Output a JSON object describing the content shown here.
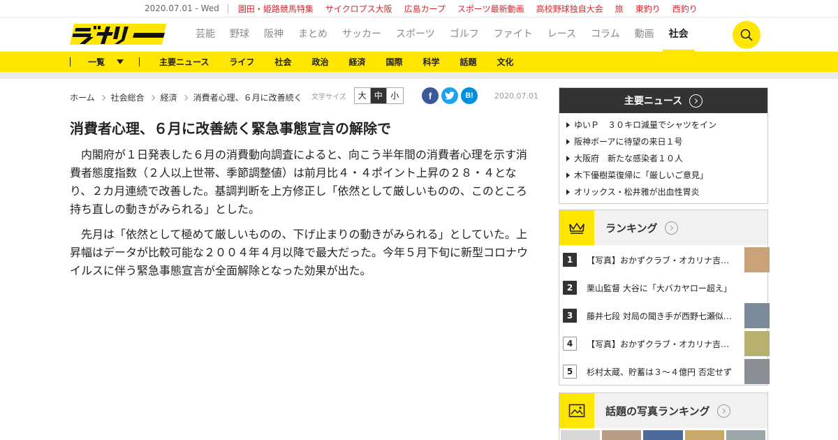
{
  "topbar": {
    "date": "2020.07.01 - Wed",
    "links": [
      "園田・姫路競馬特集",
      "サイクロプス大阪",
      "広島カープ",
      "スポーツ最新動画",
      "高校野球独自大会",
      "旅",
      "東釣り",
      "西釣り"
    ]
  },
  "header": {
    "logo_text": "デイリー",
    "nav": [
      "芸能",
      "野球",
      "阪神",
      "まとめ",
      "サッカー",
      "スポーツ",
      "ゴルフ",
      "ファイト",
      "レース",
      "コラム",
      "動画",
      "社会"
    ],
    "nav_active": "社会"
  },
  "subnav": {
    "all_label": "一覧",
    "items": [
      "主要ニュース",
      "ライフ",
      "社会",
      "政治",
      "経済",
      "国際",
      "科学",
      "話題",
      "文化"
    ]
  },
  "breadcrumb": [
    "ホーム",
    "社会総合",
    "経済",
    "消費者心理、６月に改善続く"
  ],
  "fontsize": {
    "label": "文字サイズ",
    "large": "大",
    "medium": "中",
    "small": "小"
  },
  "share": {
    "facebook": "f",
    "twitter": "t",
    "hatena": "B!"
  },
  "article": {
    "date": "2020.07.01",
    "title": "消費者心理、６月に改善続く緊急事態宣言の解除で",
    "paragraphs": [
      "内閣府が１日発表した６月の消費動向調査によると、向こう半年間の消費者心理を示す消費者態度指数（２人以上世帯、季節調整値）は前月比４・４ポイント上昇の２８・４となり、２カ月連続で改善した。基調判断を上方修正し「依然として厳しいものの、このところ持ち直しの動きがみられる」とした。",
      "先月は「依然として極めて厳しいものの、下げ止まりの動きがみられる」としていた。上昇幅はデータが比較可能な２００４年４月以降で最大だった。今年５月下旬に新型コロナウイルスに伴う緊急事態宣言が全面解除となった効果が出た。"
    ]
  },
  "sidebar": {
    "news": {
      "title": "主要ニュース",
      "items": [
        "ゆいＰ　３０キロ減量でシャツをイン",
        "阪神ボーアに待望の来日１号",
        "大阪府　新たな感染者１０人",
        "木下優樹菜復帰に「厳しいご意見」",
        "オリックス・松井雅が出血性胃炎"
      ]
    },
    "ranking": {
      "title": "ランキング",
      "items": [
        {
          "rank": "1",
          "text": "【写真】おかずクラブ・オカリナ吉岡里帆風",
          "thumb": "#c9a27a"
        },
        {
          "rank": "2",
          "text": "栗山監督 大谷に「大バカヤロー超え」",
          "thumb": ""
        },
        {
          "rank": "3",
          "text": "藤井七段 対局の聞き手が西野七瀬似と話題",
          "thumb": "#7a8a99"
        },
        {
          "rank": "4",
          "text": "【写真】おかずクラブ・オカリナ吉岡里帆風",
          "thumb": "#b8b070"
        },
        {
          "rank": "5",
          "text": "杉村太蔵、貯蓄は３～４億円 否定せず",
          "thumb": "#8a8f96"
        }
      ]
    },
    "photo_ranking": {
      "title": "話題の写真ランキング"
    }
  },
  "colors": {
    "brand_yellow": "#ffe600",
    "link_red": "#d8262c",
    "dark": "#333333"
  }
}
